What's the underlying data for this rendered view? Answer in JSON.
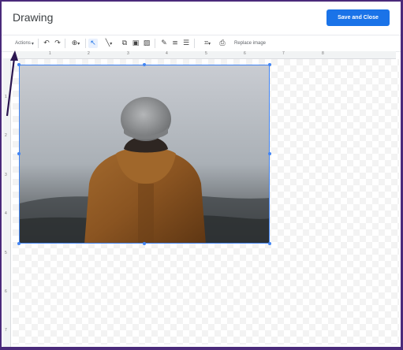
{
  "header": {
    "title": "Drawing",
    "save_label": "Save and Close"
  },
  "toolbar": {
    "actions_label": "Actions",
    "replace_image_label": "Replace image",
    "icons": [
      "undo-icon",
      "redo-icon",
      "zoom-icon",
      "select-icon",
      "line-icon",
      "shape-icon",
      "textbox-icon",
      "image-icon",
      "pen-icon",
      "line-weight-icon",
      "line-dash-icon",
      "crop-icon",
      "replace-image-icon"
    ]
  },
  "ruler": {
    "horizontal": [
      "1",
      "2",
      "3",
      "4",
      "5",
      "6",
      "7",
      "8"
    ],
    "vertical": [
      "1",
      "2",
      "3",
      "4",
      "5",
      "6",
      "7"
    ]
  },
  "colors": {
    "accent": "#1a73e8",
    "frame": "#4a2a7a",
    "selection": "#4285f4",
    "annotation_arrow": "#2a1550"
  }
}
